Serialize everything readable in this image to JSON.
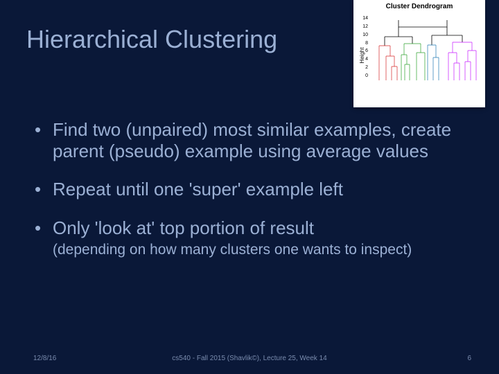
{
  "title": "Hierarchical Clustering",
  "bullets": {
    "b1": "Find two (unpaired) most similar examples, create parent (pseudo) example using average values",
    "b2": "Repeat until one 'super' example left",
    "b3": "Only 'look at' top portion of result",
    "b3_sub": "(depending on how many clusters one wants to inspect)"
  },
  "footer": {
    "date": "12/8/16",
    "center": "cs540 - Fall 2015 (Shavlik©), Lecture 25, Week 14",
    "page": "6"
  },
  "dendrogram": {
    "title": "Cluster Dendrogram",
    "ylabel": "Height",
    "ticks": [
      "14",
      "12",
      "10",
      "8",
      "6",
      "4",
      "2",
      "0"
    ]
  }
}
